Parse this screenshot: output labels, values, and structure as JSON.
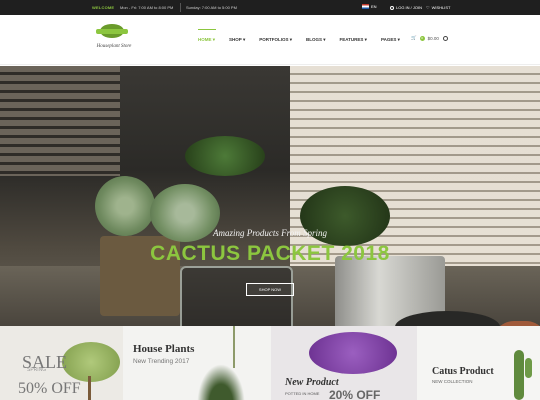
{
  "topbar": {
    "welcome": "WELCOME",
    "hours_weekday": "Mon - Fri: 7:00 AM to 8:00 PM",
    "hours_sunday": "Sunday: 7:00 AM to 5:00 PM",
    "language": "EN",
    "login": "LOG IN / JOIN",
    "wishlist": "WISHLIST"
  },
  "header": {
    "logo_name": "Houseplant Store",
    "nav": [
      "HOME",
      "SHOP",
      "PORTFOLIOS",
      "BLOGS",
      "FEATURES",
      "PAGES"
    ],
    "cart_count": "0",
    "cart_total": "$0.00"
  },
  "hero": {
    "subtitle": "Amazing Products From Spring",
    "title": "CACTUS PACKET 2018",
    "button": "SHOP NOW"
  },
  "banners": {
    "b1_big": "SALE",
    "b1_spring": "SPRING",
    "b1_off": "50% OFF",
    "b2_title": "House Plants",
    "b2_sub": "New Trending 2017",
    "b3_title": "New Product",
    "b3_sub": "POTTED IN HOME",
    "b3_pct": "20% OFF",
    "b4_title": "Catus Product",
    "b4_sub": "NEW COLLECTION"
  },
  "colors": {
    "accent": "#8cc63f",
    "topbar_bg": "#1f1f1f"
  }
}
